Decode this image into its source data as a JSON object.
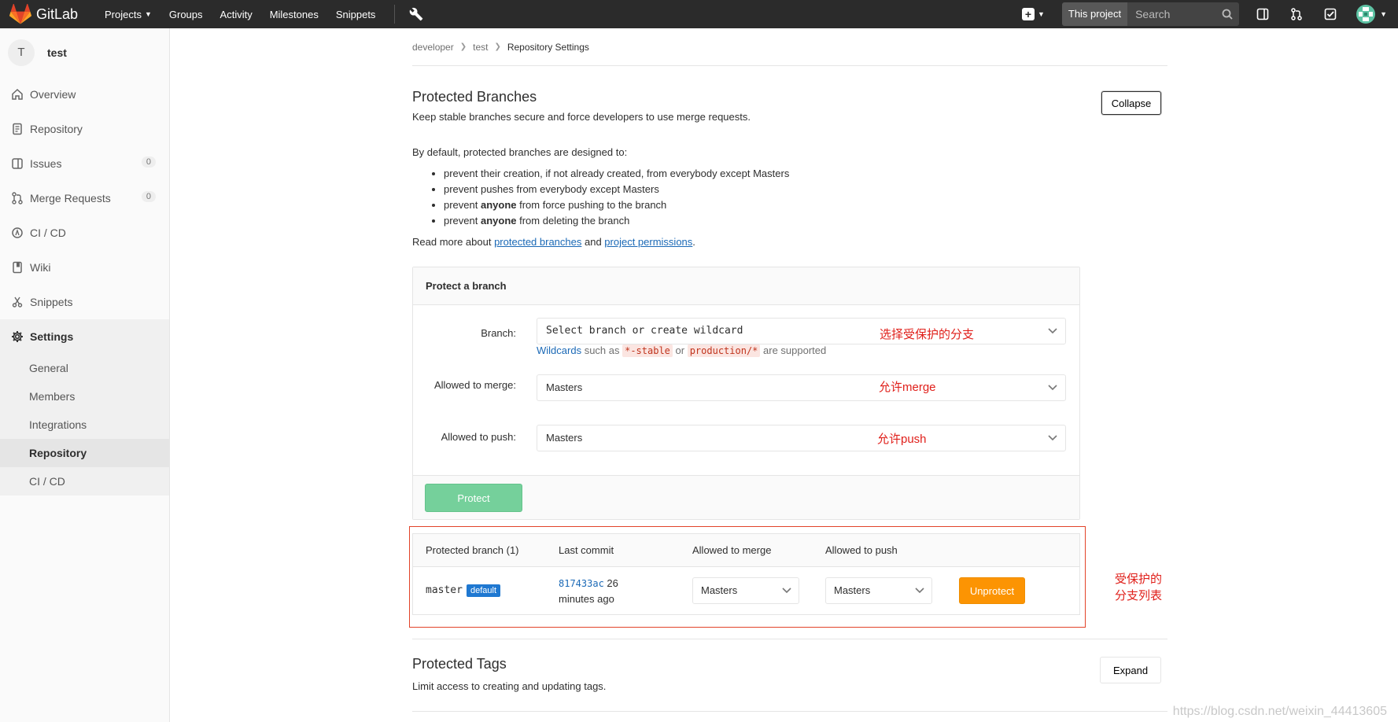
{
  "navbar": {
    "brand": "GitLab",
    "links": [
      {
        "label": "Projects",
        "dropdown": true
      },
      {
        "label": "Groups"
      },
      {
        "label": "Activity"
      },
      {
        "label": "Milestones"
      },
      {
        "label": "Snippets"
      }
    ],
    "search_scope": "This project",
    "search_placeholder": "Search"
  },
  "sidebar": {
    "project_initial": "T",
    "project_name": "test",
    "items": [
      {
        "label": "Overview",
        "icon": "home-icon"
      },
      {
        "label": "Repository",
        "icon": "doc-icon"
      },
      {
        "label": "Issues",
        "icon": "issues-icon",
        "badge": "0"
      },
      {
        "label": "Merge Requests",
        "icon": "merge-request-icon",
        "badge": "0"
      },
      {
        "label": "CI / CD",
        "icon": "rocket-icon"
      },
      {
        "label": "Wiki",
        "icon": "book-icon"
      },
      {
        "label": "Snippets",
        "icon": "scissors-icon"
      },
      {
        "label": "Settings",
        "icon": "gear-icon"
      }
    ],
    "settings_sub": [
      {
        "label": "General"
      },
      {
        "label": "Members"
      },
      {
        "label": "Integrations"
      },
      {
        "label": "Repository"
      },
      {
        "label": "CI / CD"
      }
    ]
  },
  "breadcrumb": [
    "developer",
    "test",
    "Repository Settings"
  ],
  "protected_branches": {
    "title": "Protected Branches",
    "description": "Keep stable branches secure and force developers to use merge requests.",
    "collapse_label": "Collapse",
    "default_intro": "By default, protected branches are designed to:",
    "rules": [
      {
        "pre": "prevent their creation, if not already created, from everybody except Masters",
        "bold": "",
        "post": ""
      },
      {
        "pre": "prevent pushes from everybody except Masters",
        "bold": "",
        "post": ""
      },
      {
        "pre": "prevent ",
        "bold": "anyone",
        "post": " from force pushing to the branch"
      },
      {
        "pre": "prevent ",
        "bold": "anyone",
        "post": " from deleting the branch"
      }
    ],
    "readmore_prefix": "Read more about ",
    "readmore_link1": "protected branches",
    "readmore_mid": " and ",
    "readmore_link2": "project permissions",
    "readmore_suffix": "."
  },
  "protect_form": {
    "heading": "Protect a branch",
    "branch_label": "Branch:",
    "branch_placeholder": "Select branch or create wildcard",
    "wildcards_link": "Wildcards",
    "wildcards_text1": " such as ",
    "wildcard_ex1": "*-stable",
    "wildcards_or": " or ",
    "wildcard_ex2": "production/*",
    "wildcards_text2": " are supported",
    "merge_label": "Allowed to merge:",
    "merge_value": "Masters",
    "push_label": "Allowed to push:",
    "push_value": "Masters",
    "protect_button": "Protect"
  },
  "protected_table": {
    "headers": [
      "Protected branch (1)",
      "Last commit",
      "Allowed to merge",
      "Allowed to push"
    ],
    "rows": [
      {
        "branch": "master",
        "badge": "default",
        "commit_sha": "817433ac",
        "commit_time_a": " 26",
        "commit_time_b": "minutes ago",
        "merge": "Masters",
        "push": "Masters",
        "action": "Unprotect"
      }
    ]
  },
  "annotations": {
    "branch": "选择受保护的分支",
    "merge": "允许merge",
    "push": "允许push",
    "list": "受保护的分支列表"
  },
  "protected_tags": {
    "title": "Protected Tags",
    "description": "Limit access to creating and updating tags.",
    "expand_label": "Expand"
  },
  "watermark": "https://blog.csdn.net/weixin_44413605",
  "colors": {
    "navbar": "#2b2b2b",
    "protect": "#75d09b",
    "unprotect": "#fc9403",
    "annotation": "#e0201b",
    "link": "#1b69b6"
  }
}
